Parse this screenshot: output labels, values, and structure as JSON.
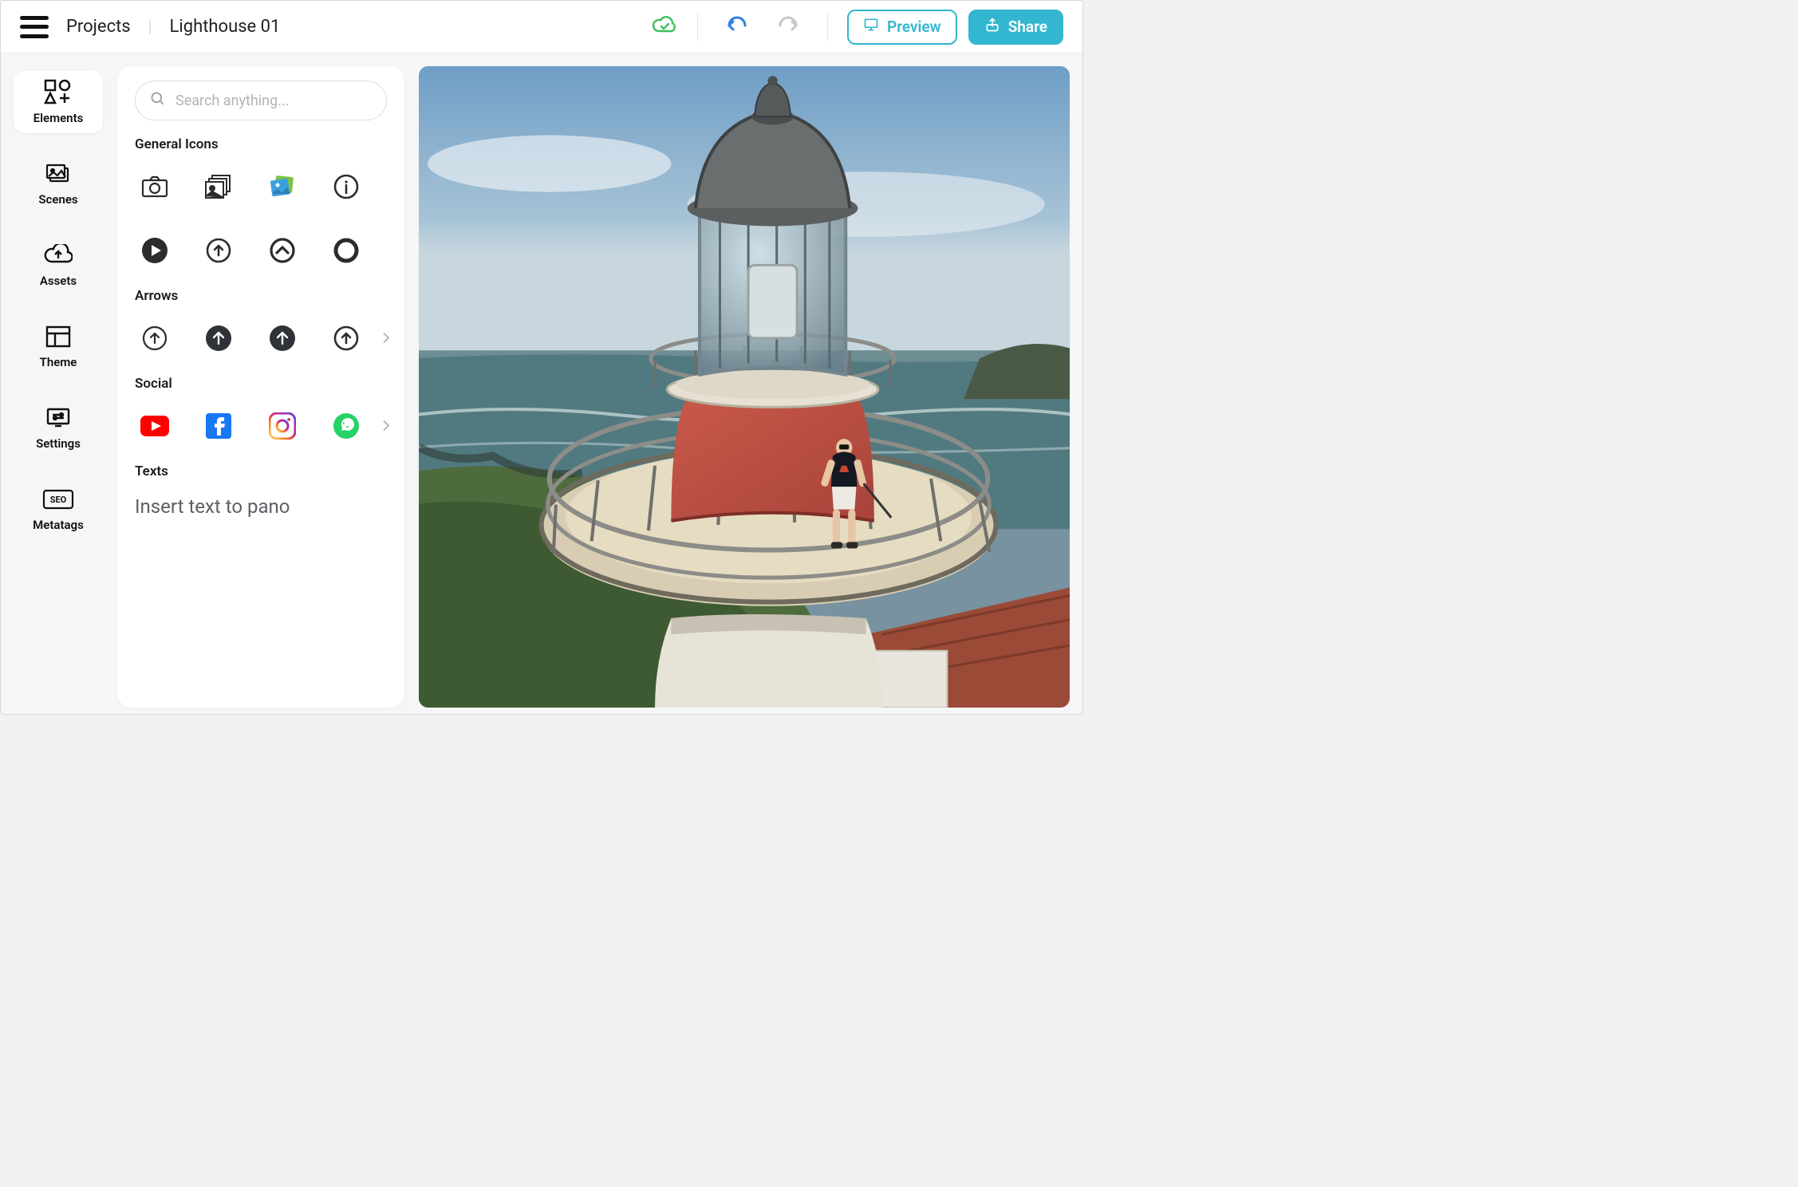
{
  "header": {
    "projects_label": "Projects",
    "project_name": "Lighthouse 01",
    "preview_label": "Preview",
    "share_label": "Share"
  },
  "sidebar": {
    "items": [
      {
        "id": "elements",
        "label": "Elements",
        "active": true
      },
      {
        "id": "scenes",
        "label": "Scenes"
      },
      {
        "id": "assets",
        "label": "Assets"
      },
      {
        "id": "theme",
        "label": "Theme"
      },
      {
        "id": "settings",
        "label": "Settings"
      },
      {
        "id": "metatags",
        "label": "Metatags"
      }
    ]
  },
  "search": {
    "placeholder": "Search anything..."
  },
  "sections": {
    "general": {
      "title": "General Icons",
      "icons": [
        "camera-icon",
        "gallery-icon",
        "picture-icon",
        "info-icon",
        "play-icon",
        "up-circle-outline-icon",
        "chevron-up-circle-icon",
        "ring-icon"
      ]
    },
    "arrows": {
      "title": "Arrows",
      "icons": [
        "arrow-up-outline-icon",
        "arrow-up-solid-dark-icon",
        "arrow-up-solid-dark2-icon",
        "arrow-up-outline2-icon"
      ]
    },
    "social": {
      "title": "Social",
      "icons": [
        "youtube-icon",
        "facebook-icon",
        "instagram-icon",
        "whatsapp-icon"
      ]
    },
    "texts": {
      "title": "Texts",
      "sample": "Insert text to pano"
    }
  }
}
